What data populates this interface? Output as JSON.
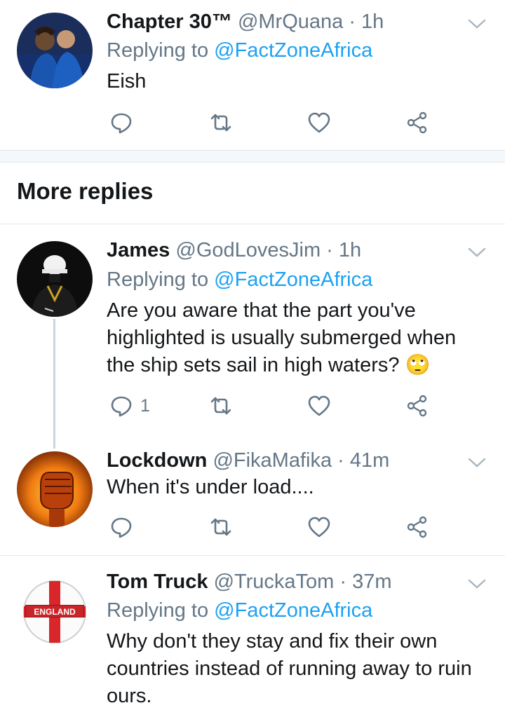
{
  "tweets": [
    {
      "name": "Chapter 30™",
      "handle": "@MrQuana · 1h",
      "replying_prefix": "Replying to ",
      "replying_to": "@FactZoneAfrica",
      "text": "Eish",
      "reply_count": ""
    },
    {
      "name": "James",
      "handle": "@GodLovesJim · 1h",
      "replying_prefix": "Replying to ",
      "replying_to": "@FactZoneAfrica",
      "text": "Are you aware that the part you've highlighted is usually submerged when the ship sets sail in high waters? 🙄",
      "reply_count": "1"
    },
    {
      "name": "Lockdown",
      "handle": "@FikaMafika · 41m",
      "text": "When it's under load....",
      "reply_count": ""
    },
    {
      "name": "Tom Truck",
      "handle": "@TruckaTom · 37m",
      "replying_prefix": "Replying to ",
      "replying_to": "@FactZoneAfrica",
      "text": "Why don't they stay and fix their own countries instead of running away to ruin ours.",
      "avatar_label": "ENGLAND"
    }
  ],
  "section": {
    "more_replies": "More replies"
  },
  "colors": {
    "accent": "#1da1f2",
    "secondary_text": "#657786",
    "icon": "#657786",
    "divider": "#e1e8ed"
  },
  "icons": [
    "reply-icon",
    "retweet-icon",
    "like-icon",
    "share-icon",
    "chevron-down-icon"
  ]
}
